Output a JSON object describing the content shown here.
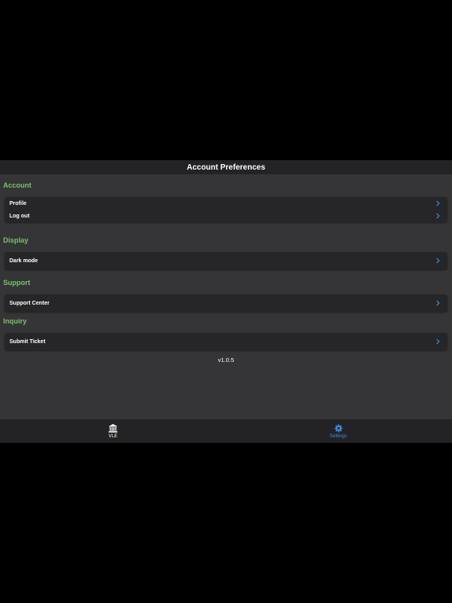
{
  "header": {
    "title": "Account Preferences"
  },
  "sections": [
    {
      "title": "Account",
      "items": [
        {
          "label": "Profile"
        },
        {
          "label": "Log out"
        }
      ]
    },
    {
      "title": "Display",
      "items": [
        {
          "label": "Dark mode"
        }
      ]
    },
    {
      "title": "Support",
      "items": [
        {
          "label": "Support Center"
        }
      ]
    },
    {
      "title": "Inquiry",
      "items": [
        {
          "label": "Submit Ticket"
        }
      ]
    }
  ],
  "version": "v1.0.5",
  "tabbar": {
    "tabs": [
      {
        "label": "VLE",
        "icon": "bank-icon",
        "active": false
      },
      {
        "label": "Settings",
        "icon": "gear-icon",
        "active": true
      }
    ]
  },
  "colors": {
    "accent_green": "#7ac16d",
    "active_blue": "#3f8de0",
    "surface": "#353436",
    "card": "#262527"
  }
}
